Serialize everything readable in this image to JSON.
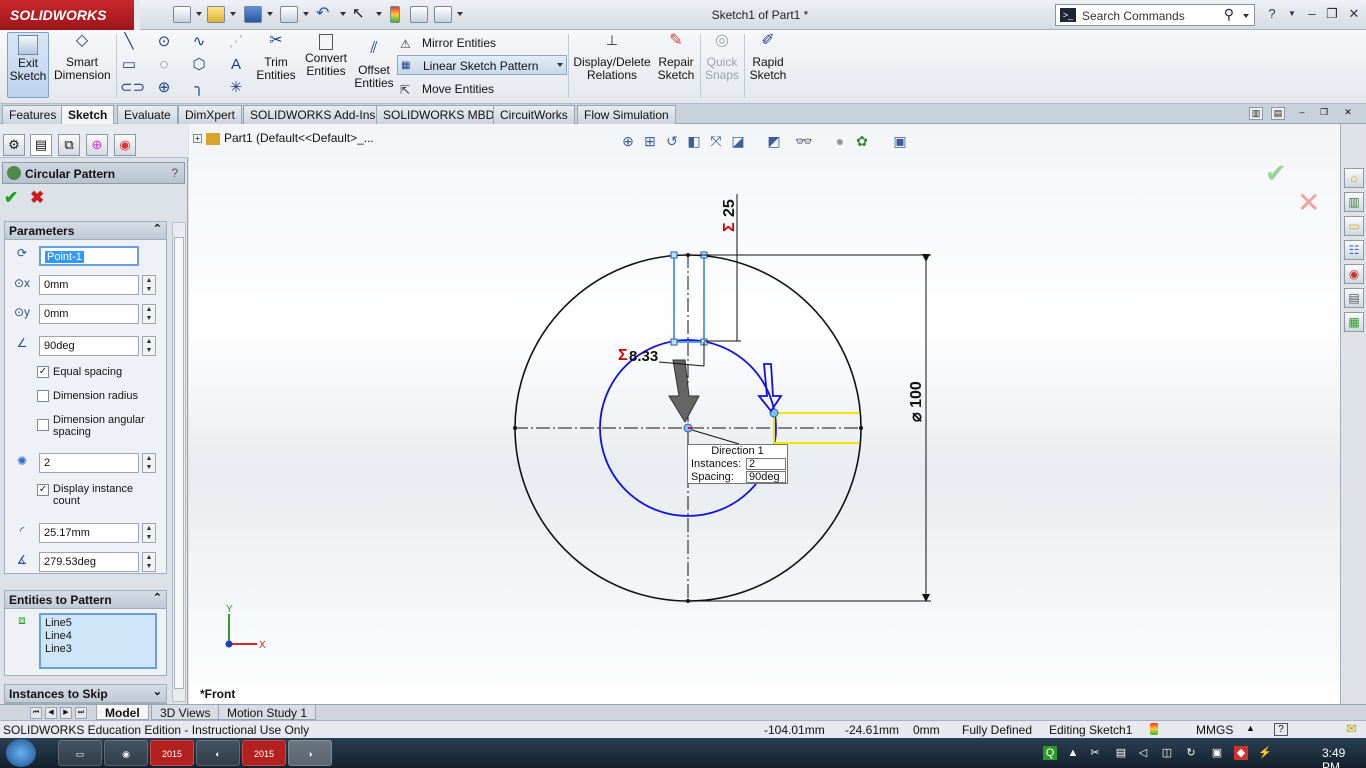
{
  "app": {
    "logo_text": "SOLIDWORKS",
    "window_title": "Sketch1 of Part1 *",
    "search_placeholder": "Search Commands",
    "help_glyph": "?"
  },
  "command_manager": {
    "exit_sketch": "Exit Sketch",
    "smart_dimension": "Smart Dimension",
    "trim_entities": "Trim Entities",
    "convert_entities": "Convert Entities",
    "offset_entities": "Offset Entities",
    "mirror_entities": "Mirror Entities",
    "linear_sketch_pattern": "Linear Sketch Pattern",
    "move_entities": "Move Entities",
    "display_delete_relations": "Display/Delete Relations",
    "repair_sketch": "Repair Sketch",
    "quick_snaps": "Quick Snaps",
    "rapid_sketch": "Rapid Sketch"
  },
  "tabs": [
    "Features",
    "Sketch",
    "Evaluate",
    "DimXpert",
    "SOLIDWORKS Add-Ins",
    "SOLIDWORKS MBD",
    "CircuitWorks",
    "Flow Simulation"
  ],
  "active_tab": "Sketch",
  "property_manager": {
    "title": "Circular Pattern",
    "help": "?",
    "parameters": {
      "header": "Parameters",
      "center_point": "Point-1",
      "center_x": "0mm",
      "center_y": "0mm",
      "angle": "90deg",
      "equal_spacing_label": "Equal spacing",
      "equal_spacing_checked": true,
      "dimension_radius_label": "Dimension radius",
      "dimension_radius_checked": false,
      "dimension_angular_spacing_label": "Dimension angular spacing",
      "dimension_angular_spacing_checked": false,
      "instances": "2",
      "display_instance_count_label": "Display instance count",
      "display_instance_count_checked": true,
      "radius": "25.17mm",
      "arc_angle": "279.53deg"
    },
    "entities_to_pattern": {
      "header": "Entities to Pattern",
      "items": [
        "Line5",
        "Line4",
        "Line3"
      ]
    },
    "instances_to_skip": {
      "header": "Instances to Skip"
    }
  },
  "graphics": {
    "tree_root": "Part1  (Default<<Default>_...",
    "view_label": "*Front",
    "dim_25": "25",
    "dim_833": "8.33",
    "dim_diameter": "⌀ 100",
    "callout": {
      "title": "Direction 1",
      "instances_label": "Instances:",
      "instances_value": "2",
      "spacing_label": "Spacing:",
      "spacing_value": "90deg"
    },
    "triad_x": "X",
    "triad_y": "Y"
  },
  "bottom_tabs": [
    "Model",
    "3D Views",
    "Motion Study 1"
  ],
  "active_bottom_tab": "Model",
  "status_bar": {
    "edition": "SOLIDWORKS Education Edition - Instructional Use Only",
    "x": "-104.01mm",
    "y": "-24.61mm",
    "z": "0mm",
    "state": "Fully Defined",
    "editing": "Editing Sketch1",
    "units": "MMGS"
  },
  "taskbar": {
    "clock": "3:49 PM",
    "app_badges": [
      "2015",
      "2015"
    ]
  },
  "colors": {
    "sketch_blue": "#1010e6",
    "geometry_black": "#111111",
    "selection_yellow": "#f1e600",
    "dim_red": "#d40000"
  }
}
